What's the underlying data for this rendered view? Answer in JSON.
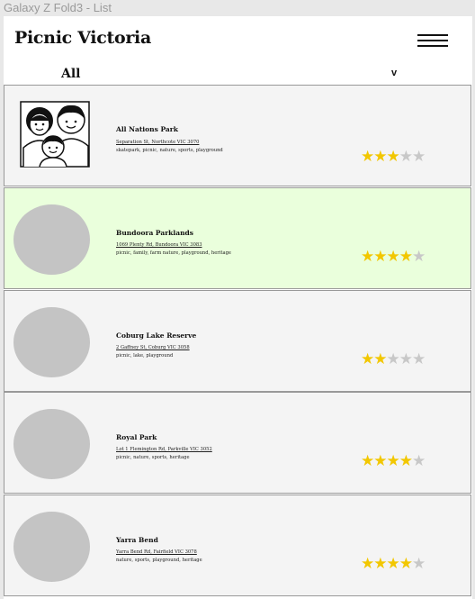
{
  "frame": {
    "label": "Galaxy Z Fold3 - List"
  },
  "header": {
    "title": "Picnic Victoria",
    "menu_icon": "hamburger-menu-icon"
  },
  "filter": {
    "label": "All",
    "chevron": "v"
  },
  "colors": {
    "star_on": "#f2c700",
    "star_off": "#c8c8c8",
    "highlight": "#eaffdc",
    "card_bg": "#f4f4f4",
    "placeholder": "#c4c4c4"
  },
  "parks": [
    {
      "name": "All Nations Park",
      "address": "Separation St, Northcote VIC 3070",
      "tags": "skatepark, picnic, nature, sports, playground",
      "rating": 3,
      "max_rating": 5,
      "image": "family-icon",
      "highlighted": false
    },
    {
      "name": "Bundoora Parklands",
      "address": "1069 Plenty Rd, Bundoora VIC 3083",
      "tags": "picnic, family, farm nature, playground, heritage",
      "rating": 4,
      "max_rating": 5,
      "image": "placeholder",
      "highlighted": true
    },
    {
      "name": "Coburg Lake Reserve",
      "address": "2 Gaffney St, Coburg VIC 3058",
      "tags": "picnic, lake, playground",
      "rating": 2,
      "max_rating": 5,
      "image": "placeholder",
      "highlighted": false
    },
    {
      "name": "Royal Park",
      "address": "Lot 1 Flemington Rd, Parkville VIC 3052",
      "tags": "picnic, nature, sports, heritage",
      "rating": 4,
      "max_rating": 5,
      "image": "placeholder",
      "highlighted": false
    },
    {
      "name": "Yarra Bend",
      "address": "Yarra Bend Rd, Fairfield VIC 3078",
      "tags": "nature, sports, playground, heritage",
      "rating": 4,
      "max_rating": 5,
      "image": "placeholder",
      "highlighted": false
    }
  ]
}
